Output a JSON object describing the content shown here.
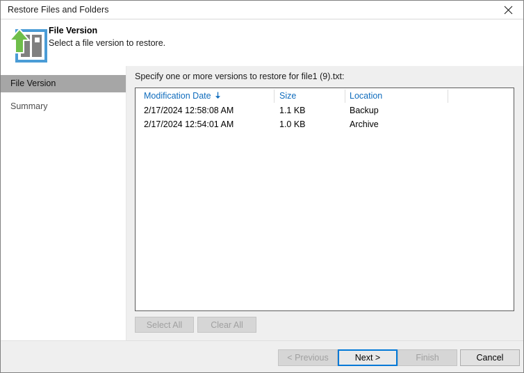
{
  "window": {
    "title": "Restore Files and Folders",
    "close_icon": "close-icon"
  },
  "header": {
    "icon": "restore-upload-icon",
    "title": "File Version",
    "subtitle": "Select a file version to restore."
  },
  "sidebar": {
    "items": [
      {
        "label": "File Version",
        "selected": true
      },
      {
        "label": "Summary",
        "selected": false
      }
    ]
  },
  "main": {
    "instruction": "Specify one or more versions to restore for file1 (9).txt:",
    "table": {
      "columns": [
        {
          "label": "Modification Date",
          "sort": "descending",
          "sort_icon": "sort-down-arrow-icon"
        },
        {
          "label": "Size",
          "sort": "none"
        },
        {
          "label": "Location",
          "sort": "none"
        }
      ],
      "rows": [
        {
          "date": "2/17/2024 12:58:08 AM",
          "size": "1.1 KB",
          "location": "Backup"
        },
        {
          "date": "2/17/2024 12:54:01 AM",
          "size": "1.0 KB",
          "location": "Archive"
        }
      ]
    },
    "select_all_label": "Select All",
    "clear_all_label": "Clear All"
  },
  "footer": {
    "previous_label": "< Previous",
    "next_label": "Next >",
    "finish_label": "Finish",
    "cancel_label": "Cancel"
  },
  "colors": {
    "header_link": "#0f6cbd",
    "focus_border": "#0078d7",
    "selection_bg": "#a6a6a6",
    "icon_green": "#6fbe4a",
    "icon_blue": "#4a9cd6",
    "icon_gray": "#808080"
  }
}
